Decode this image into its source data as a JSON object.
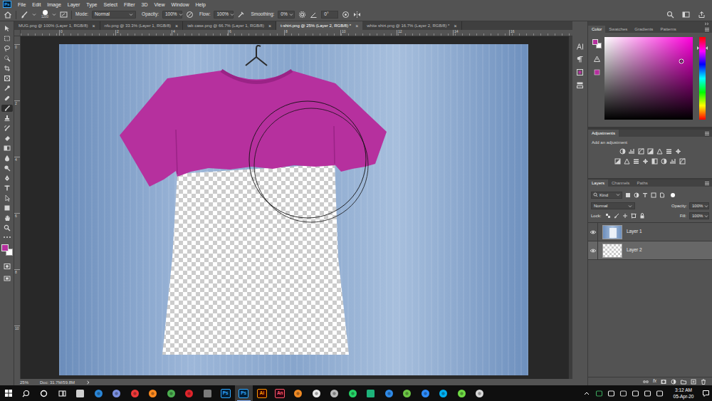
{
  "app": {
    "logo": "Ps"
  },
  "menu": [
    "File",
    "Edit",
    "Image",
    "Layer",
    "Type",
    "Select",
    "Filter",
    "3D",
    "View",
    "Window",
    "Help"
  ],
  "options": {
    "brush_size": "1200",
    "mode_label": "Mode:",
    "mode": "Normal",
    "opacity_label": "Opacity:",
    "opacity": "100%",
    "flow_label": "Flow:",
    "flow": "100%",
    "smoothing_label": "Smoothing:",
    "smoothing": "0%",
    "angle": "0°"
  },
  "document_tabs": {
    "close": "×",
    "items": [
      {
        "label": "MUG.png @ 100% (Layer 1, RGB/8)",
        "selected": false
      },
      {
        "label": "nfu.png @ 33.3% (Layer 1, RGB/8)",
        "selected": false
      },
      {
        "label": "tab case.png @ 66.7% (Layer 1, RGB/8)",
        "selected": false
      },
      {
        "label": "t-shirt.png @ 25% (Layer 2, RGB/8) *",
        "selected": true
      },
      {
        "label": "white shirt.png @ 16.7% (Layer 2, RGB/8) *",
        "selected": false
      }
    ]
  },
  "rulers": {
    "horizontal": [
      "0",
      "2",
      "4",
      "6",
      "8",
      "10",
      "12",
      "14",
      "16"
    ],
    "vertical": [
      "0",
      "2",
      "4",
      "6",
      "8",
      "10"
    ]
  },
  "toolbar": {
    "tools": [
      {
        "kind": "move",
        "selected": false
      },
      {
        "kind": "marquee",
        "selected": false
      },
      {
        "kind": "lasso",
        "selected": false
      },
      {
        "kind": "quickselect",
        "selected": false
      },
      {
        "kind": "crop",
        "selected": false
      },
      {
        "kind": "frame",
        "selected": false
      },
      {
        "kind": "eyedropper",
        "selected": false
      },
      {
        "kind": "healing",
        "selected": false
      },
      {
        "kind": "brush",
        "selected": true
      },
      {
        "kind": "stamp",
        "selected": false
      },
      {
        "kind": "history",
        "selected": false
      },
      {
        "kind": "eraser",
        "selected": false
      },
      {
        "kind": "gradient",
        "selected": false
      },
      {
        "kind": "blur",
        "selected": false
      },
      {
        "kind": "dodge",
        "selected": false
      },
      {
        "kind": "pen",
        "selected": false
      },
      {
        "kind": "type",
        "selected": false
      },
      {
        "kind": "pathselect",
        "selected": false
      },
      {
        "kind": "shape",
        "selected": false
      },
      {
        "kind": "hand",
        "selected": false
      },
      {
        "kind": "zoom",
        "selected": false
      }
    ]
  },
  "colors": {
    "foreground": "#b6309e",
    "background": "#ffffff",
    "hue": "#ff00dc",
    "saturation": 0.87,
    "brightness": 0.71,
    "hue_level": 0.13
  },
  "status_bar": {
    "zoom": "25%",
    "doc": "Doc: 31.7M/59.8M"
  },
  "color_panel": {
    "tabs": [
      {
        "label": "Color",
        "selected": true
      },
      {
        "label": "Swatches",
        "selected": false
      },
      {
        "label": "Gradients",
        "selected": false
      },
      {
        "label": "Patterns",
        "selected": false
      }
    ]
  },
  "adjustments_panel": {
    "tabs": [
      {
        "label": "Adjustments",
        "selected": true
      }
    ],
    "hint": "Add an adjustment"
  },
  "layers_panel": {
    "tabs": [
      {
        "label": "Layers",
        "selected": true
      },
      {
        "label": "Channels",
        "selected": false
      },
      {
        "label": "Paths",
        "selected": false
      }
    ],
    "filter": "Kind",
    "blend": "Normal",
    "opacity_label": "Opacity:",
    "opacity": "100%",
    "lock_label": "Lock:",
    "fill_label": "Fill:",
    "fill": "100%",
    "fx": "fx",
    "layers": [
      {
        "name": "Layer 1",
        "kind": "photo",
        "visible": true,
        "selected": false
      },
      {
        "name": "Layer 2",
        "kind": "transparent",
        "visible": true,
        "selected": true
      }
    ]
  },
  "taskbar": {
    "apps": [
      {
        "kind": "store",
        "selected": false
      },
      {
        "kind": "edge",
        "selected": false
      },
      {
        "kind": "chromium",
        "selected": false
      },
      {
        "kind": "vivaldi",
        "selected": false
      },
      {
        "kind": "firefox",
        "selected": false
      },
      {
        "kind": "chrome",
        "selected": false
      },
      {
        "kind": "opera",
        "selected": false
      },
      {
        "kind": "calculator",
        "selected": false
      },
      {
        "kind": "photoshop",
        "label": "Ps",
        "selected": false
      },
      {
        "kind": "photoshop",
        "label": "Ps",
        "selected": true
      },
      {
        "kind": "illustrator",
        "label": "Ai",
        "selected": false
      },
      {
        "kind": "animate",
        "label": "An",
        "selected": false
      },
      {
        "kind": "blender",
        "selected": false
      },
      {
        "kind": "inkscape",
        "selected": false
      },
      {
        "kind": "unity",
        "selected": false
      },
      {
        "kind": "whatsapp",
        "selected": false
      },
      {
        "kind": "terminal",
        "selected": false
      },
      {
        "kind": "messenger",
        "selected": false
      },
      {
        "kind": "camtasia",
        "selected": false
      },
      {
        "kind": "zoom",
        "selected": false
      },
      {
        "kind": "skype",
        "selected": false
      },
      {
        "kind": "upwork",
        "selected": false
      },
      {
        "kind": "obs",
        "selected": false
      }
    ],
    "time": "3:12 AM",
    "date": "05-Apr-20"
  }
}
